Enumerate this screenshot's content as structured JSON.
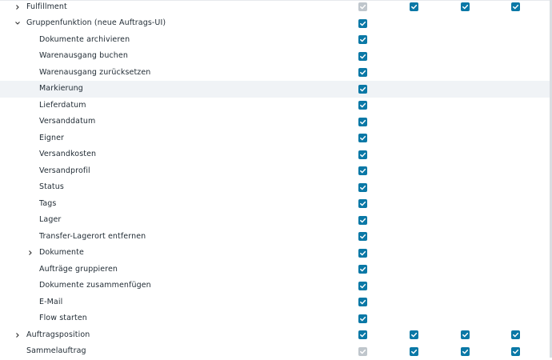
{
  "rows": [
    {
      "label": "Fulfillment",
      "indent": 0,
      "chevron": ">",
      "checks": [
        "disabled",
        "checked",
        "checked",
        "checked"
      ],
      "highlight": false
    },
    {
      "label": "Gruppenfunktion (neue Auftrags-UI)",
      "indent": 0,
      "chevron": "v",
      "checks": [
        "checked",
        "none",
        "none",
        "none"
      ],
      "highlight": false
    },
    {
      "label": "Dokumente archivieren",
      "indent": 1,
      "chevron": "",
      "checks": [
        "checked",
        "none",
        "none",
        "none"
      ],
      "highlight": false
    },
    {
      "label": "Warenausgang buchen",
      "indent": 1,
      "chevron": "",
      "checks": [
        "checked",
        "none",
        "none",
        "none"
      ],
      "highlight": false
    },
    {
      "label": "Warenausgang zurücksetzen",
      "indent": 1,
      "chevron": "",
      "checks": [
        "checked",
        "none",
        "none",
        "none"
      ],
      "highlight": false
    },
    {
      "label": "Markierung",
      "indent": 1,
      "chevron": "",
      "checks": [
        "checked",
        "none",
        "none",
        "none"
      ],
      "highlight": true
    },
    {
      "label": "Lieferdatum",
      "indent": 1,
      "chevron": "",
      "checks": [
        "checked",
        "none",
        "none",
        "none"
      ],
      "highlight": false
    },
    {
      "label": "Versanddatum",
      "indent": 1,
      "chevron": "",
      "checks": [
        "checked",
        "none",
        "none",
        "none"
      ],
      "highlight": false
    },
    {
      "label": "Eigner",
      "indent": 1,
      "chevron": "",
      "checks": [
        "checked",
        "none",
        "none",
        "none"
      ],
      "highlight": false
    },
    {
      "label": "Versandkosten",
      "indent": 1,
      "chevron": "",
      "checks": [
        "checked",
        "none",
        "none",
        "none"
      ],
      "highlight": false
    },
    {
      "label": "Versandprofil",
      "indent": 1,
      "chevron": "",
      "checks": [
        "checked",
        "none",
        "none",
        "none"
      ],
      "highlight": false
    },
    {
      "label": "Status",
      "indent": 1,
      "chevron": "",
      "checks": [
        "checked",
        "none",
        "none",
        "none"
      ],
      "highlight": false
    },
    {
      "label": "Tags",
      "indent": 1,
      "chevron": "",
      "checks": [
        "checked",
        "none",
        "none",
        "none"
      ],
      "highlight": false
    },
    {
      "label": "Lager",
      "indent": 1,
      "chevron": "",
      "checks": [
        "checked",
        "none",
        "none",
        "none"
      ],
      "highlight": false
    },
    {
      "label": "Transfer-Lagerort entfernen",
      "indent": 1,
      "chevron": "",
      "checks": [
        "checked",
        "none",
        "none",
        "none"
      ],
      "highlight": false
    },
    {
      "label": "Dokumente",
      "indent": 1,
      "chevron": ">",
      "checks": [
        "checked",
        "none",
        "none",
        "none"
      ],
      "highlight": false
    },
    {
      "label": "Aufträge gruppieren",
      "indent": 1,
      "chevron": "",
      "checks": [
        "checked",
        "none",
        "none",
        "none"
      ],
      "highlight": false
    },
    {
      "label": "Dokumente zusammenfügen",
      "indent": 1,
      "chevron": "",
      "checks": [
        "checked",
        "none",
        "none",
        "none"
      ],
      "highlight": false
    },
    {
      "label": "E-Mail",
      "indent": 1,
      "chevron": "",
      "checks": [
        "checked",
        "none",
        "none",
        "none"
      ],
      "highlight": false
    },
    {
      "label": "Flow starten",
      "indent": 1,
      "chevron": "",
      "checks": [
        "checked",
        "none",
        "none",
        "none"
      ],
      "highlight": false
    },
    {
      "label": "Auftragsposition",
      "indent": 0,
      "chevron": ">",
      "checks": [
        "checked",
        "checked",
        "checked",
        "checked"
      ],
      "highlight": false
    },
    {
      "label": "Sammelauftrag",
      "indent": 0,
      "chevron": "",
      "checks": [
        "disabled",
        "checked",
        "checked",
        "checked"
      ],
      "highlight": false
    }
  ],
  "colors": {
    "accent": "#0a78a6",
    "disabled": "#bfc6cc",
    "highlight": "#f0f3f6"
  },
  "icons": {
    "expand": "chevron-right-icon",
    "collapse": "chevron-down-icon",
    "check": "checkmark-icon"
  }
}
